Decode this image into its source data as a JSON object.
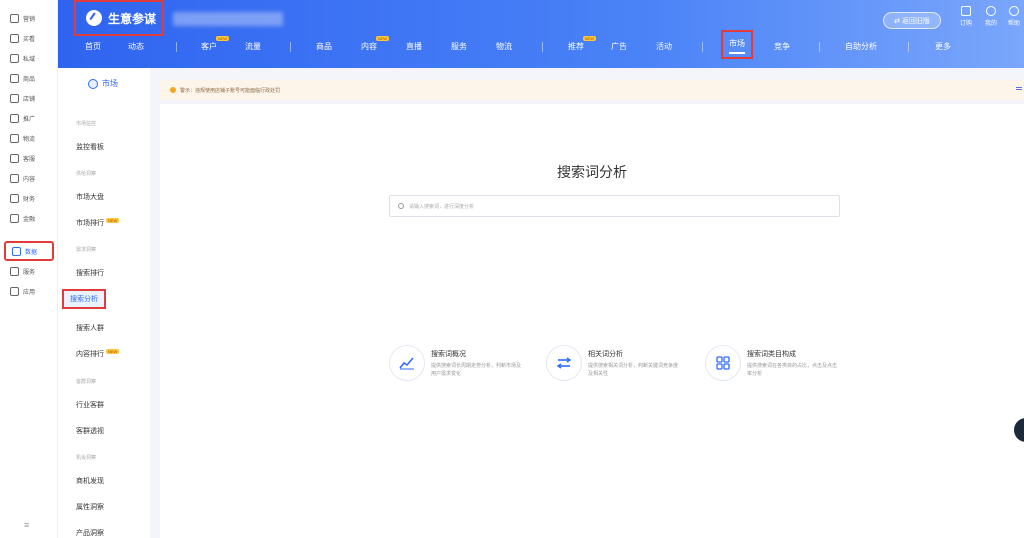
{
  "rail": {
    "items": [
      {
        "label": "营销",
        "icon": "megaphone-icon"
      },
      {
        "label": "买看",
        "icon": "document-icon"
      },
      {
        "label": "私域",
        "icon": "users-icon"
      },
      {
        "label": "商品",
        "icon": "bag-icon"
      },
      {
        "label": "店铺",
        "icon": "store-icon"
      },
      {
        "label": "推广",
        "icon": "pin-icon"
      },
      {
        "label": "物流",
        "icon": "truck-icon"
      },
      {
        "label": "客服",
        "icon": "headset-icon"
      },
      {
        "label": "内容",
        "icon": "content-icon"
      },
      {
        "label": "财务",
        "icon": "money-icon"
      },
      {
        "label": "金融",
        "icon": "finance-icon"
      },
      {
        "label": "数据",
        "icon": "chart-icon",
        "active": true
      },
      {
        "label": "服务",
        "icon": "grid-icon"
      },
      {
        "label": "应用",
        "icon": "apps-icon"
      }
    ],
    "collapse": "≡"
  },
  "header": {
    "brand": "生意参谋",
    "return_label": "⇄ 返回旧版",
    "icons": [
      {
        "label": "订购",
        "icon": "cart-icon"
      },
      {
        "label": "我的",
        "icon": "user-icon"
      },
      {
        "label": "帮助",
        "icon": "help-icon"
      }
    ],
    "nav": [
      {
        "label": "首页"
      },
      {
        "label": "动态"
      },
      {
        "label": "客户",
        "badge": "NEW"
      },
      {
        "label": "流量"
      },
      {
        "label": "商品"
      },
      {
        "label": "内容",
        "badge": "NEW"
      },
      {
        "label": "直播"
      },
      {
        "label": "服务"
      },
      {
        "label": "物流"
      },
      {
        "label": "推荐",
        "badge": "NEW"
      },
      {
        "label": "广告"
      },
      {
        "label": "活动"
      },
      {
        "label": "市场",
        "active": true
      },
      {
        "label": "竞争"
      },
      {
        "label": "自助分析"
      },
      {
        "label": "更多"
      }
    ]
  },
  "subnav": {
    "title": "市场",
    "groups": [
      {
        "label": "市场监控"
      },
      {
        "label": "供给洞察"
      },
      {
        "label": "需求洞察"
      },
      {
        "label": "客群洞察"
      },
      {
        "label": "机会洞察"
      }
    ],
    "items": [
      {
        "label": "监控看板"
      },
      {
        "label": "市场大盘"
      },
      {
        "label": "市场排行",
        "badge": "NEW"
      },
      {
        "label": "搜索排行"
      },
      {
        "label": "搜索分析",
        "active": true
      },
      {
        "label": "搜索人群"
      },
      {
        "label": "内容排行",
        "badge": "NEW"
      },
      {
        "label": "行业客群"
      },
      {
        "label": "客群透视"
      },
      {
        "label": "商机发现"
      },
      {
        "label": "属性洞察"
      },
      {
        "label": "产品洞察"
      }
    ]
  },
  "notice": {
    "text": "警示：违规使用店铺子账号可能面临行政处罚"
  },
  "main": {
    "title": "搜索词分析",
    "search_placeholder": "请输入搜索词，进行深度分析",
    "cards": [
      {
        "title": "搜索词概况",
        "desc": "提供搜索词长周期走势分析，判断市场及用户需求变化",
        "icon": "trend-icon"
      },
      {
        "title": "相关词分析",
        "desc": "提供搜索相关词分析，判断关键词竞争度及相关性",
        "icon": "swap-icon"
      },
      {
        "title": "搜索词类目构成",
        "desc": "提供搜索词在各类目的占比，点击及点击率分析",
        "icon": "category-icon"
      }
    ]
  },
  "colors": {
    "accent": "#2f6bff",
    "highlight": "#e23b3b",
    "header_start": "#2f64f0",
    "header_end": "#7aa6fb"
  }
}
